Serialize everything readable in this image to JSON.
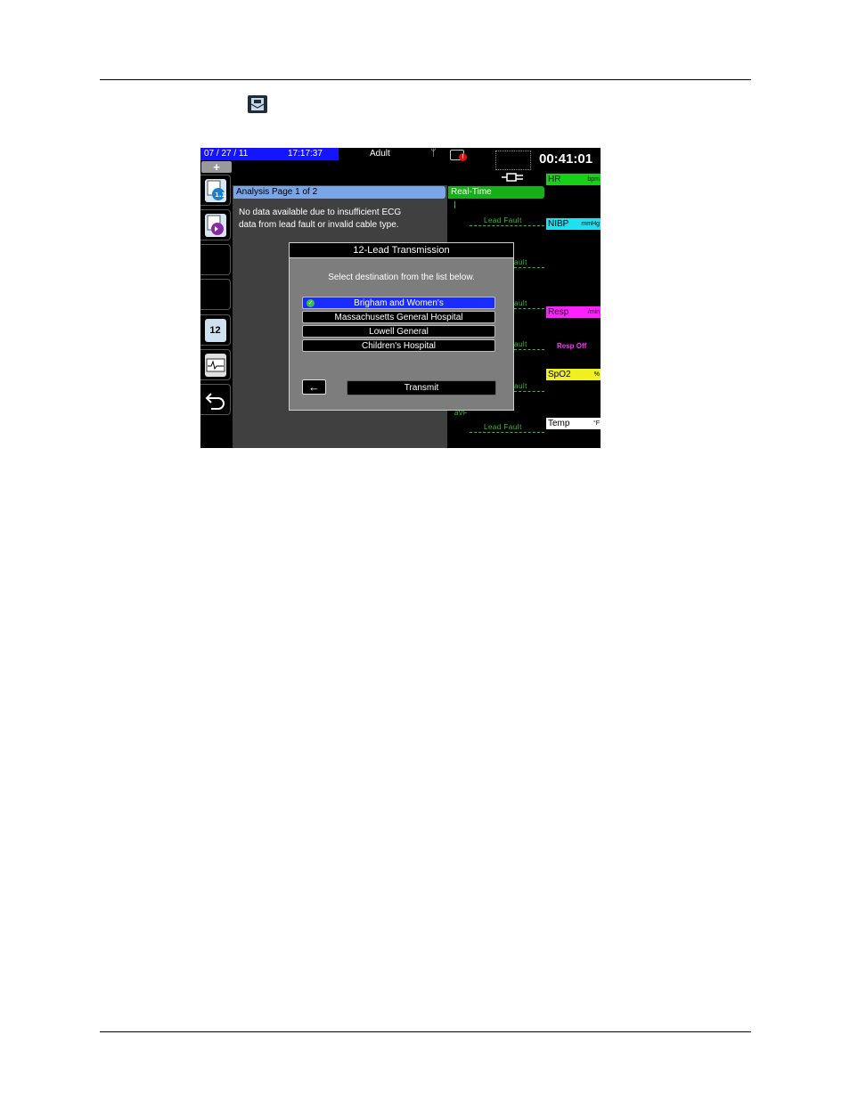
{
  "status_bar": {
    "date": "07 / 27 / 11",
    "time": "17:17:37",
    "patient_type": "Adult",
    "elapsed": "00:41:01"
  },
  "softkeys": {
    "plus_label": "+",
    "twelve_lead_label": "12"
  },
  "analysis": {
    "header": "Analysis Page 1 of 2",
    "message_line1": "No data available due to insufficient ECG",
    "message_line2": "data from lead fault or invalid cable type."
  },
  "realtime": {
    "header": "Real-Time",
    "lead_fault": "Lead Fault",
    "fault_fragment": "ault",
    "fault_fragment2": "ault",
    "fault_fragment3": "ault",
    "fault_fragment4": "ault",
    "fault_fragment5": "ault",
    "resp_off": "Resp Off",
    "avf": "aVF"
  },
  "vitals": {
    "hr": {
      "label": "HR",
      "unit": "bpm",
      "color": "#18d018"
    },
    "nibp": {
      "label": "NIBP",
      "unit": "mmHg",
      "color": "#20e0f0"
    },
    "resp": {
      "label": "Resp",
      "unit": "/min",
      "color": "#ff20ff"
    },
    "spo2": {
      "label": "SpO2",
      "unit": "%",
      "color": "#f0f020"
    },
    "temp": {
      "label": "Temp",
      "unit": "°F",
      "color": "#ffffff"
    }
  },
  "dialog": {
    "title": "12-Lead Transmission",
    "prompt": "Select destination from the list below.",
    "destinations": [
      {
        "label": "Brigham and Women's",
        "selected": true
      },
      {
        "label": "Massachusetts General Hospital",
        "selected": false
      },
      {
        "label": "Lowell General",
        "selected": false
      },
      {
        "label": "Children's Hospital",
        "selected": false
      }
    ],
    "back_label": "←",
    "transmit_label": "Transmit"
  }
}
